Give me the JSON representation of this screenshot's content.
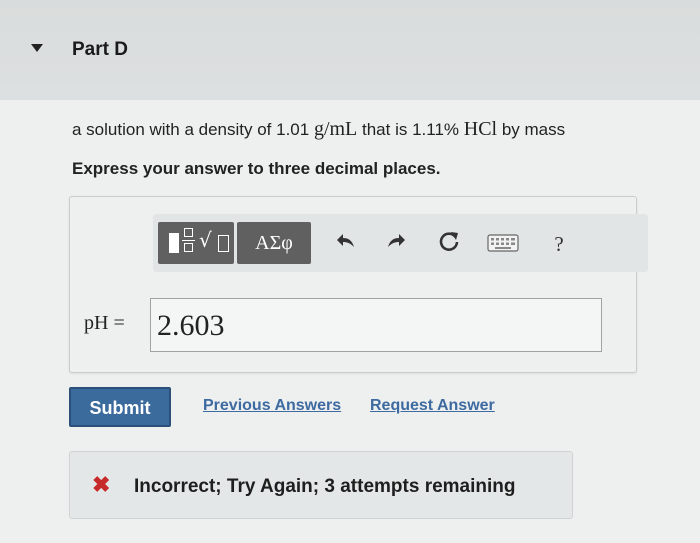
{
  "part": {
    "title": "Part D",
    "toggle_icon": "caret-down-icon"
  },
  "question": {
    "prefix": "a solution with a density of 1.01 ",
    "unit": "g/mL",
    "middle": " that is 1.11% ",
    "formula": "HCl",
    "suffix": " by mass"
  },
  "instruction": "Express your answer to three decimal places.",
  "toolbar": {
    "templates_icon": "templates-icon",
    "greek_label": "ΑΣφ",
    "undo_icon": "undo-icon",
    "redo_icon": "redo-icon",
    "reset_icon": "reset-icon",
    "keyboard_icon": "keyboard-icon",
    "help_label": "?"
  },
  "answer": {
    "label": "pH =",
    "value": "2.603"
  },
  "actions": {
    "submit_label": "Submit",
    "previous_answers_label": "Previous Answers",
    "request_answer_label": "Request Answer"
  },
  "feedback": {
    "status_icon": "incorrect-x-icon",
    "message": "Incorrect; Try Again; 3 attempts remaining",
    "accent_color": "#c62a2a"
  },
  "colors": {
    "submit_button": "#3b6b9c",
    "link": "#3d6aa0"
  }
}
